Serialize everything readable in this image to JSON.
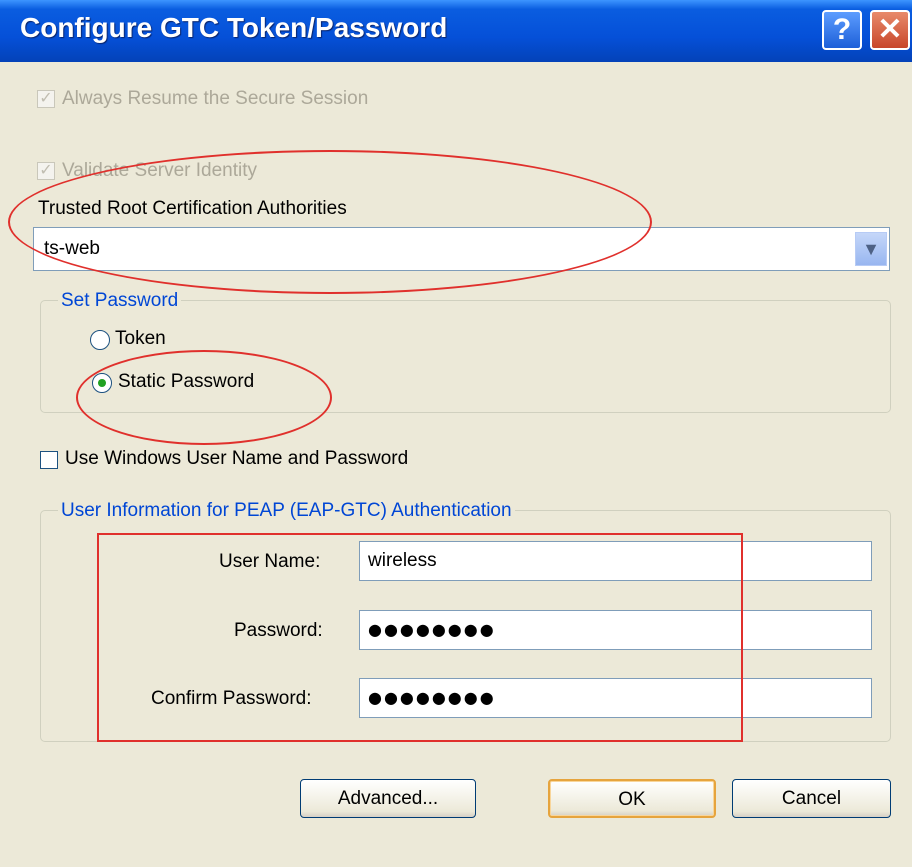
{
  "window": {
    "title": "Configure GTC Token/Password",
    "help_glyph": "?",
    "close_glyph": "✕"
  },
  "options": {
    "always_resume": {
      "label": "Always Resume the Secure Session",
      "checked": true,
      "enabled": false
    },
    "validate_server": {
      "label": "Validate Server Identity",
      "checked": true,
      "enabled": false
    }
  },
  "trusted_root": {
    "label": "Trusted Root Certification Authorities",
    "selected": "ts-web"
  },
  "set_password": {
    "title": "Set Password",
    "options": [
      {
        "label": "Token",
        "selected": false
      },
      {
        "label": "Static Password",
        "selected": true
      }
    ]
  },
  "use_windows": {
    "label": "Use Windows User Name and Password",
    "checked": false
  },
  "user_info": {
    "title": "User Information for PEAP (EAP-GTC) Authentication",
    "username_label": "User Name:",
    "username_value": "wireless",
    "password_label": "Password:",
    "password_mask": "●●●●●●●●",
    "confirm_label": "Confirm Password:",
    "confirm_mask": "●●●●●●●●"
  },
  "buttons": {
    "advanced": "Advanced...",
    "ok": "OK",
    "cancel": "Cancel"
  },
  "icons": {
    "checkmark": "check-icon",
    "dropdown": "chevron-down-icon",
    "help": "help-icon",
    "close": "close-icon"
  },
  "colors": {
    "title_bar": "#0a5de0",
    "group_title": "#0046d5",
    "annotation": "#e0302c",
    "default_button_border": "#e6a43d"
  }
}
